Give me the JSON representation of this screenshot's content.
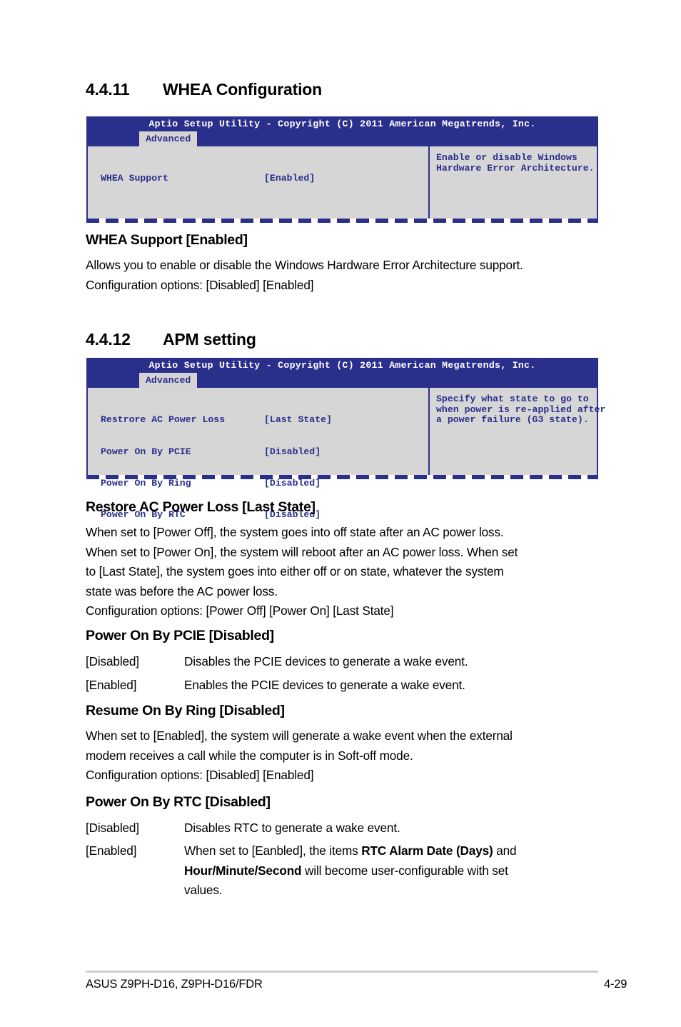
{
  "sections": [
    {
      "number": "4.4.11",
      "title": "WHEA Configuration"
    },
    {
      "number": "4.4.12",
      "title": "APM setting"
    }
  ],
  "bios_screens": [
    {
      "title": "Aptio Setup Utility - Copyright (C) 2011 American Megatrends, Inc.",
      "tab": "Advanced",
      "rows": [
        {
          "label": "WHEA Support",
          "value": "[Enabled]"
        }
      ],
      "help": "Enable or disable Windows\nHardware Error Architecture."
    },
    {
      "title": "Aptio Setup Utility - Copyright (C) 2011 American Megatrends, Inc.",
      "tab": "Advanced",
      "rows": [
        {
          "label": "Restrore AC Power Loss",
          "value": "[Last State]"
        },
        {
          "label": "Power On By PCIE",
          "value": "[Disabled]"
        },
        {
          "label": "Power On By Ring",
          "value": "[Disabled]"
        },
        {
          "label": "Power On By RTC",
          "value": "[Disabled]"
        }
      ],
      "help": "Specify what state to go to\nwhen power is re-applied after\na power failure (G3 state)."
    }
  ],
  "whea_support": {
    "heading": "WHEA Support [Enabled]",
    "line1": "Allows you to enable or disable the Windows Hardware Error Architecture support.",
    "line2": "Configuration options: [Disabled] [Enabled]"
  },
  "restore_ac": {
    "heading": "Restore AC Power Loss [Last State]",
    "line1": "When set to [Power Off], the system goes into off state after an AC power loss.",
    "line2": "When set to [Power On], the system will reboot after an AC power loss. When set",
    "line3": "to [Last State], the system goes into either off or on state, whatever the system",
    "line4": "state was before the AC power loss.",
    "line5": "Configuration options: [Power Off] [Power On] [Last State]"
  },
  "power_on_pcie": {
    "heading": "Power On By PCIE [Disabled]",
    "disabled_tag": "[Disabled]",
    "disabled_text": "Disables the PCIE devices to generate a wake event.",
    "enabled_tag": "[Enabled]",
    "enabled_text": "Enables the PCIE devices to generate a wake event."
  },
  "resume_ring": {
    "heading": "Resume On By Ring [Disabled]",
    "line1": "When set to [Enabled], the system will generate a wake event when the external",
    "line2": "modem receives a call while the computer is in Soft-off mode.",
    "line3": "Configuration options: [Disabled] [Enabled]"
  },
  "power_on_rtc": {
    "heading": "Power On By RTC [Disabled]",
    "disabled_tag": "[Disabled]",
    "disabled_text": "Disables RTC to generate a wake event.",
    "enabled_tag": "[Enabled]",
    "enabled_line1_a": "When set to [Eanbled], the items ",
    "enabled_line1_b": "RTC Alarm Date (Days)",
    "enabled_line1_c": " and",
    "enabled_line2_a": "Hour/Minute/Second",
    "enabled_line2_b": " will become user-configurable with set",
    "enabled_line3": "values."
  },
  "footer": {
    "left": "ASUS Z9PH-D16, Z9PH-D16/FDR",
    "right": "4-29"
  },
  "colors": {
    "bios_blue": "#2b2f8c",
    "bios_panel": "#d6d6d6",
    "bios_tab_bg": "#d4d4d4",
    "footer_rule": "#cfcfcf"
  }
}
